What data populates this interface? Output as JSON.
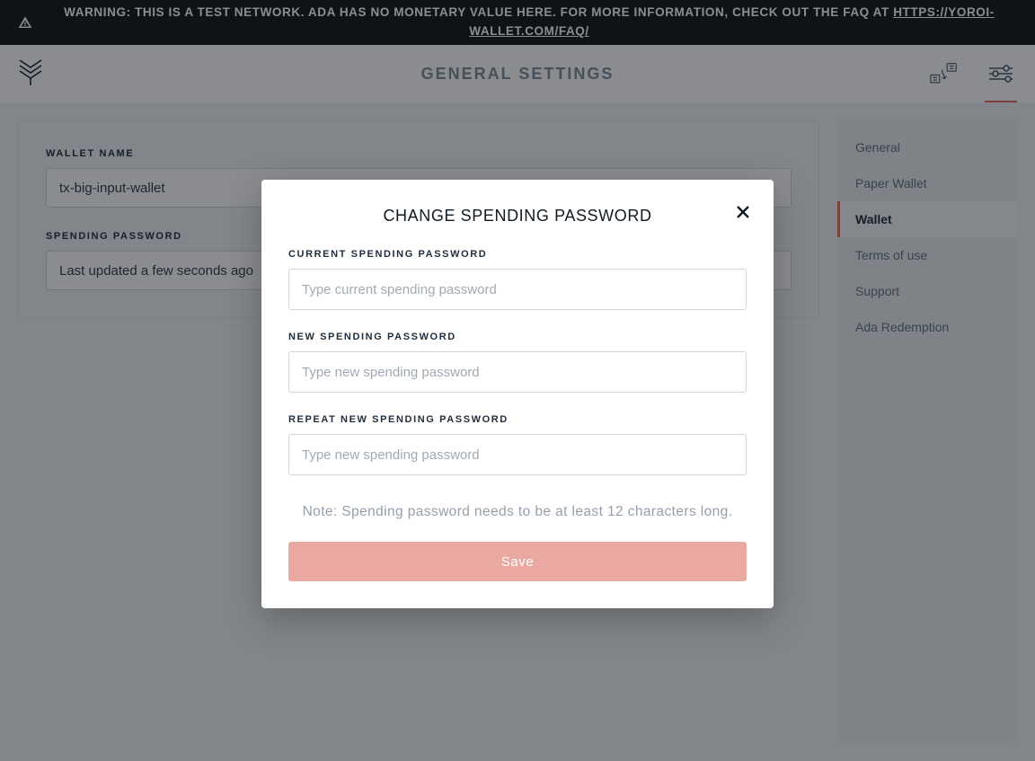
{
  "warning": {
    "text_prefix": "WARNING: THIS IS A TEST NETWORK. ADA HAS NO MONETARY VALUE HERE. FOR MORE INFORMATION, CHECK OUT THE FAQ AT ",
    "link_text": "HTTPS://YOROI-WALLET.COM/FAQ/"
  },
  "header": {
    "title": "GENERAL SETTINGS"
  },
  "wallet_panel": {
    "name_label": "WALLET NAME",
    "name_value": "tx-big-input-wallet",
    "pw_label": "SPENDING PASSWORD",
    "pw_value": "Last updated a few seconds ago"
  },
  "sidebar": {
    "items": [
      {
        "label": "General"
      },
      {
        "label": "Paper Wallet"
      },
      {
        "label": "Wallet"
      },
      {
        "label": "Terms of use"
      },
      {
        "label": "Support"
      },
      {
        "label": "Ada Redemption"
      }
    ],
    "active_index": 2
  },
  "modal": {
    "title": "CHANGE SPENDING PASSWORD",
    "current_label": "CURRENT SPENDING PASSWORD",
    "current_placeholder": "Type current spending password",
    "new_label": "NEW SPENDING PASSWORD",
    "new_placeholder": "Type new spending password",
    "repeat_label": "REPEAT NEW SPENDING PASSWORD",
    "repeat_placeholder": "Type new spending password",
    "note": "Note: Spending password needs to be at least 12 characters long.",
    "save_label": "Save"
  },
  "colors": {
    "accent": "#e56b6b",
    "save_disabled": "#e9a9a2"
  }
}
